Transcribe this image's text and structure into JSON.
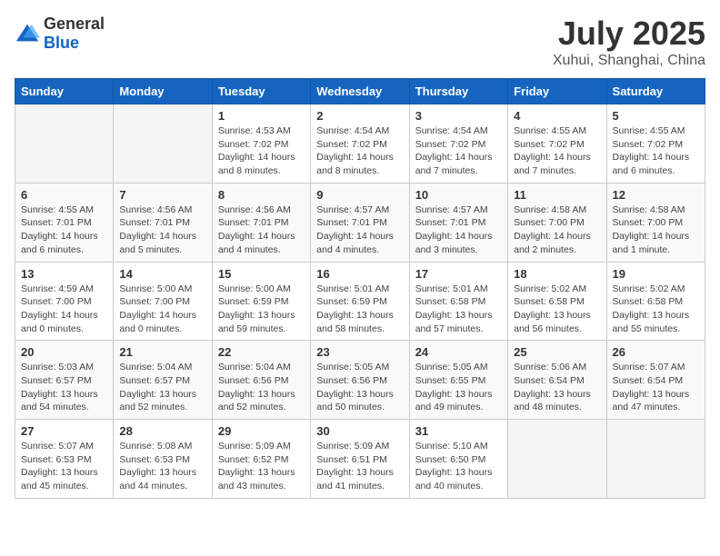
{
  "header": {
    "logo": {
      "general": "General",
      "blue": "Blue"
    },
    "title": "July 2025",
    "location": "Xuhui, Shanghai, China"
  },
  "days_of_week": [
    "Sunday",
    "Monday",
    "Tuesday",
    "Wednesday",
    "Thursday",
    "Friday",
    "Saturday"
  ],
  "weeks": [
    [
      {
        "day": "",
        "content": ""
      },
      {
        "day": "",
        "content": ""
      },
      {
        "day": "1",
        "content": "Sunrise: 4:53 AM\nSunset: 7:02 PM\nDaylight: 14 hours and 8 minutes."
      },
      {
        "day": "2",
        "content": "Sunrise: 4:54 AM\nSunset: 7:02 PM\nDaylight: 14 hours and 8 minutes."
      },
      {
        "day": "3",
        "content": "Sunrise: 4:54 AM\nSunset: 7:02 PM\nDaylight: 14 hours and 7 minutes."
      },
      {
        "day": "4",
        "content": "Sunrise: 4:55 AM\nSunset: 7:02 PM\nDaylight: 14 hours and 7 minutes."
      },
      {
        "day": "5",
        "content": "Sunrise: 4:55 AM\nSunset: 7:02 PM\nDaylight: 14 hours and 6 minutes."
      }
    ],
    [
      {
        "day": "6",
        "content": "Sunrise: 4:55 AM\nSunset: 7:01 PM\nDaylight: 14 hours and 6 minutes."
      },
      {
        "day": "7",
        "content": "Sunrise: 4:56 AM\nSunset: 7:01 PM\nDaylight: 14 hours and 5 minutes."
      },
      {
        "day": "8",
        "content": "Sunrise: 4:56 AM\nSunset: 7:01 PM\nDaylight: 14 hours and 4 minutes."
      },
      {
        "day": "9",
        "content": "Sunrise: 4:57 AM\nSunset: 7:01 PM\nDaylight: 14 hours and 4 minutes."
      },
      {
        "day": "10",
        "content": "Sunrise: 4:57 AM\nSunset: 7:01 PM\nDaylight: 14 hours and 3 minutes."
      },
      {
        "day": "11",
        "content": "Sunrise: 4:58 AM\nSunset: 7:00 PM\nDaylight: 14 hours and 2 minutes."
      },
      {
        "day": "12",
        "content": "Sunrise: 4:58 AM\nSunset: 7:00 PM\nDaylight: 14 hours and 1 minute."
      }
    ],
    [
      {
        "day": "13",
        "content": "Sunrise: 4:59 AM\nSunset: 7:00 PM\nDaylight: 14 hours and 0 minutes."
      },
      {
        "day": "14",
        "content": "Sunrise: 5:00 AM\nSunset: 7:00 PM\nDaylight: 14 hours and 0 minutes."
      },
      {
        "day": "15",
        "content": "Sunrise: 5:00 AM\nSunset: 6:59 PM\nDaylight: 13 hours and 59 minutes."
      },
      {
        "day": "16",
        "content": "Sunrise: 5:01 AM\nSunset: 6:59 PM\nDaylight: 13 hours and 58 minutes."
      },
      {
        "day": "17",
        "content": "Sunrise: 5:01 AM\nSunset: 6:58 PM\nDaylight: 13 hours and 57 minutes."
      },
      {
        "day": "18",
        "content": "Sunrise: 5:02 AM\nSunset: 6:58 PM\nDaylight: 13 hours and 56 minutes."
      },
      {
        "day": "19",
        "content": "Sunrise: 5:02 AM\nSunset: 6:58 PM\nDaylight: 13 hours and 55 minutes."
      }
    ],
    [
      {
        "day": "20",
        "content": "Sunrise: 5:03 AM\nSunset: 6:57 PM\nDaylight: 13 hours and 54 minutes."
      },
      {
        "day": "21",
        "content": "Sunrise: 5:04 AM\nSunset: 6:57 PM\nDaylight: 13 hours and 52 minutes."
      },
      {
        "day": "22",
        "content": "Sunrise: 5:04 AM\nSunset: 6:56 PM\nDaylight: 13 hours and 52 minutes."
      },
      {
        "day": "23",
        "content": "Sunrise: 5:05 AM\nSunset: 6:56 PM\nDaylight: 13 hours and 50 minutes."
      },
      {
        "day": "24",
        "content": "Sunrise: 5:05 AM\nSunset: 6:55 PM\nDaylight: 13 hours and 49 minutes."
      },
      {
        "day": "25",
        "content": "Sunrise: 5:06 AM\nSunset: 6:54 PM\nDaylight: 13 hours and 48 minutes."
      },
      {
        "day": "26",
        "content": "Sunrise: 5:07 AM\nSunset: 6:54 PM\nDaylight: 13 hours and 47 minutes."
      }
    ],
    [
      {
        "day": "27",
        "content": "Sunrise: 5:07 AM\nSunset: 6:53 PM\nDaylight: 13 hours and 45 minutes."
      },
      {
        "day": "28",
        "content": "Sunrise: 5:08 AM\nSunset: 6:53 PM\nDaylight: 13 hours and 44 minutes."
      },
      {
        "day": "29",
        "content": "Sunrise: 5:09 AM\nSunset: 6:52 PM\nDaylight: 13 hours and 43 minutes."
      },
      {
        "day": "30",
        "content": "Sunrise: 5:09 AM\nSunset: 6:51 PM\nDaylight: 13 hours and 41 minutes."
      },
      {
        "day": "31",
        "content": "Sunrise: 5:10 AM\nSunset: 6:50 PM\nDaylight: 13 hours and 40 minutes."
      },
      {
        "day": "",
        "content": ""
      },
      {
        "day": "",
        "content": ""
      }
    ]
  ]
}
